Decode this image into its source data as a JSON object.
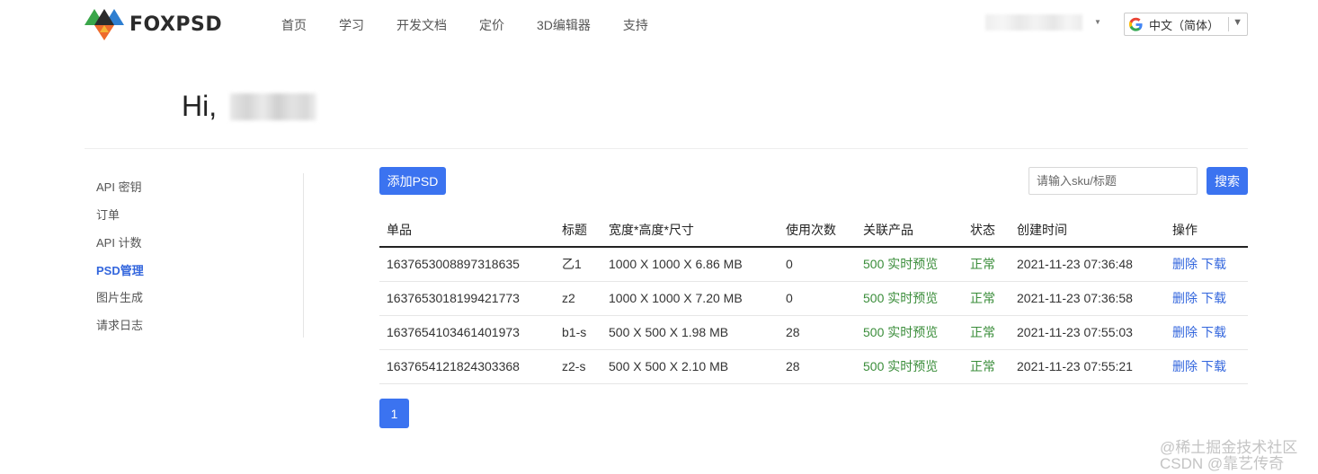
{
  "header": {
    "logo_text": "FOXPSD",
    "nav": [
      "首页",
      "学习",
      "开发文档",
      "定价",
      "3D编辑器",
      "支持"
    ],
    "language": "中文（简体）",
    "language_arrow": "▼"
  },
  "greeting": "Hi,",
  "sidebar": {
    "items": [
      "API 密钥",
      "订单",
      "API 计数",
      "PSD管理",
      "图片生成",
      "请求日志"
    ],
    "active": "PSD管理"
  },
  "toolbar": {
    "add_label": "添加PSD",
    "search_placeholder": "请输入sku/标题",
    "search_label": "搜索"
  },
  "table": {
    "headers": [
      "单品",
      "标题",
      "宽度*高度*尺寸",
      "使用次数",
      "关联产品",
      "状态",
      "创建时间",
      "操作"
    ],
    "rows": [
      {
        "sku": "1637653008897318635",
        "title": "乙1",
        "size": "1000 X 1000 X 6.86 MB",
        "uses": "0",
        "product": "500 实时预览",
        "status": "正常",
        "created": "2021-11-23 07:36:48",
        "delete": "删除",
        "download": "下载"
      },
      {
        "sku": "1637653018199421773",
        "title": "z2",
        "size": "1000 X 1000 X 7.20 MB",
        "uses": "0",
        "product": "500 实时预览",
        "status": "正常",
        "created": "2021-11-23 07:36:58",
        "delete": "删除",
        "download": "下载"
      },
      {
        "sku": "1637654103461401973",
        "title": "b1-s",
        "size": "500 X 500 X 1.98 MB",
        "uses": "28",
        "product": "500 实时预览",
        "status": "正常",
        "created": "2021-11-23 07:55:03",
        "delete": "删除",
        "download": "下载"
      },
      {
        "sku": "1637654121824303368",
        "title": "z2-s",
        "size": "500 X 500 X 2.10 MB",
        "uses": "28",
        "product": "500 实时预览",
        "status": "正常",
        "created": "2021-11-23 07:55:21",
        "delete": "删除",
        "download": "下载"
      }
    ]
  },
  "pagination": {
    "current": "1"
  },
  "watermark": [
    "@稀土掘金技术社区",
    "CSDN @靠艺传奇"
  ],
  "colors": {
    "accent": "#3b73f0",
    "link": "#3366dd",
    "status_green": "#3a8d3a"
  },
  "icons": {
    "logo": "foxpsd-triangle-logo",
    "language": "google-g-icon"
  }
}
